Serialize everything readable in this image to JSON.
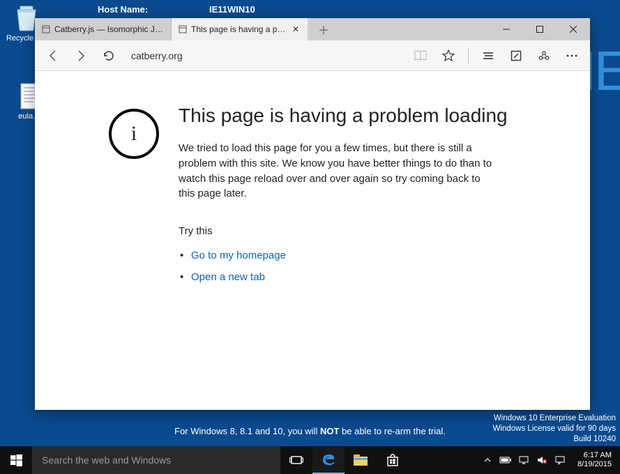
{
  "desktop": {
    "recycle_label": "Recycle Bin",
    "eula_label": "eula.txt",
    "host_label": "Host Name:",
    "host_value": "IE11WIN10"
  },
  "browser": {
    "tabs": [
      {
        "label": "Catberry.js — Isomorphic JavaScript Framework"
      },
      {
        "label": "This page is having a problem loading"
      }
    ],
    "address": "catberry.org",
    "error": {
      "title": "This page is having a problem loading",
      "body": "We tried to load this page for you a few times, but there is still a problem with this site. We know you have better things to do than to watch this page reload over and over again so try coming back to this page later.",
      "try_label": "Try this",
      "links": [
        "Go to my homepage",
        "Open a new tab"
      ]
    }
  },
  "watermark": {
    "l1": "Windows 10 Enterprise Evaluation",
    "l2": "Windows License valid for 90 days",
    "l3": "Build 10240"
  },
  "rearm_pre": "For Windows 8, 8.1 and 10, you will ",
  "rearm_bold": "NOT",
  "rearm_post": " be able to re-arm the trial.",
  "taskbar": {
    "search_placeholder": "Search the web and Windows",
    "time": "6:17 AM",
    "date": "8/19/2015"
  }
}
